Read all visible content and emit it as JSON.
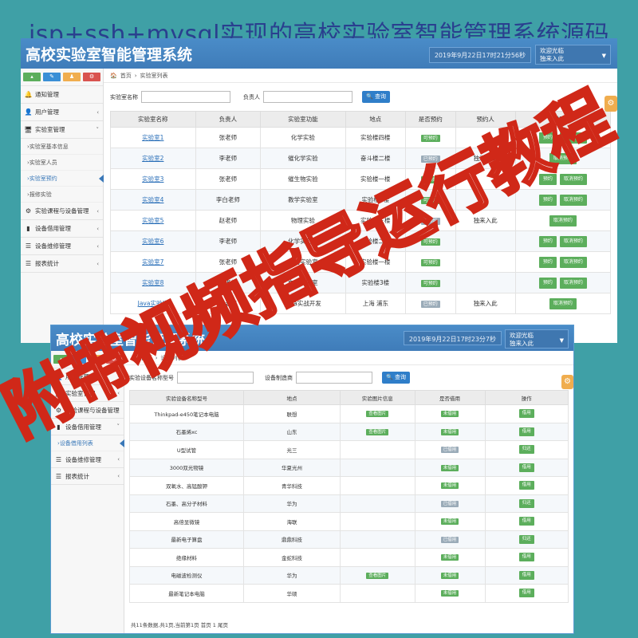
{
  "banner": "jsp+ssh+mysql实现的高校实验室智能管理系统源码",
  "watermark": "附带视频指导运行教程",
  "colors": {
    "header": "#3f7cb9",
    "accent": "#2f7ec9",
    "green": "#5cae5c",
    "gray": "#9aabb8",
    "watermark": "#d02818",
    "banner": "#2a3f8f"
  },
  "s1": {
    "title": "高校实验室智能管理系统",
    "datetime": "2019年9月22日17时21分56秒",
    "user_line1": "欢迎光临",
    "user_line2": "独来入此",
    "sidebar": {
      "items": [
        {
          "icon": "bell-icon",
          "glyph": "🔔",
          "label": "通知管理",
          "chev": ""
        },
        {
          "icon": "user-icon",
          "glyph": "👤",
          "label": "用户管理",
          "chev": "‹"
        },
        {
          "icon": "monitor-icon",
          "glyph": "🖥",
          "label": "实验室管理",
          "chev": "˅"
        }
      ],
      "subs": [
        "实验室基本信息",
        "实验室人员",
        "实验室预约",
        "报修实验"
      ],
      "items2": [
        {
          "icon": "gears-icon",
          "glyph": "⚙",
          "label": "实验课程与设备管理",
          "chev": "‹"
        },
        {
          "icon": "bookmark-icon",
          "glyph": "▮",
          "label": "设备借用管理",
          "chev": "‹"
        },
        {
          "icon": "list-icon",
          "glyph": "☰",
          "label": "设备维修管理",
          "chev": "‹"
        },
        {
          "icon": "list-icon",
          "glyph": "☰",
          "label": "报表统计",
          "chev": "‹"
        }
      ]
    },
    "crumb_home": "首页",
    "crumb_page": "实验室列表",
    "search": {
      "label1": "实验室名称",
      "label2": "负责人",
      "button": "查询"
    },
    "table": {
      "headers": [
        "实验室名称",
        "负责人",
        "实验室功能",
        "地点",
        "是否预约",
        "预约人",
        "操作"
      ],
      "rows": [
        {
          "name": "实验室1",
          "owner": "张老师",
          "func": "化学实验",
          "loc": "实验楼四楼",
          "status": "可预约",
          "sg": "g",
          "who": "",
          "acts": [
            "预约",
            "取消预约"
          ]
        },
        {
          "name": "实验室2",
          "owner": "李老师",
          "func": "催化学实验",
          "loc": "奋斗楼二楼",
          "status": "已预约",
          "sg": "gr",
          "who": "独来入此",
          "acts": [
            "取消预约"
          ]
        },
        {
          "name": "实验室3",
          "owner": "张老师",
          "func": "催生物实验",
          "loc": "实验楼一楼",
          "status": "可预约",
          "sg": "g",
          "who": "",
          "acts": [
            "预约",
            "取消预约"
          ]
        },
        {
          "name": "实验室4",
          "owner": "李白老师",
          "func": "教学实验室",
          "loc": "实验楼2楼",
          "status": "可预约",
          "sg": "g",
          "who": "",
          "acts": [
            "预约",
            "取消预约"
          ]
        },
        {
          "name": "实验室5",
          "owner": "赵老师",
          "func": "物理实验",
          "loc": "实验楼三楼",
          "status": "已预约",
          "sg": "gr",
          "who": "独来入此",
          "acts": [
            "取消预约"
          ]
        },
        {
          "name": "实验室6",
          "owner": "李老师",
          "func": "化学实验室",
          "loc": "实验楼二楼",
          "status": "可预约",
          "sg": "g",
          "who": "",
          "acts": [
            "预约",
            "取消预约"
          ]
        },
        {
          "name": "实验室7",
          "owner": "张老师",
          "func": "生物实验室",
          "loc": "实验楼一楼",
          "status": "可预约",
          "sg": "g",
          "who": "",
          "acts": [
            "预约",
            "取消预约"
          ]
        },
        {
          "name": "实验室8",
          "owner": "张老师",
          "func": "电路实验室",
          "loc": "实验楼3楼",
          "status": "可预约",
          "sg": "g",
          "who": "",
          "acts": [
            "预约",
            "取消预约"
          ]
        },
        {
          "name": "Java实验室",
          "owner": "张老师",
          "func": "Java实战开发",
          "loc": "上海 浦东",
          "status": "已预约",
          "sg": "gr",
          "who": "独来入此",
          "acts": [
            "取消预约"
          ]
        }
      ]
    }
  },
  "s2": {
    "title": "高校实验室智能管理系统",
    "datetime": "2019年9月22日17时23分7秒",
    "user_line1": "欢迎光临",
    "user_line2": "独来入此",
    "sidebar": {
      "items": [
        {
          "icon": "user-icon",
          "glyph": "👤",
          "label": "用户管理",
          "chev": "‹"
        },
        {
          "icon": "monitor-icon",
          "glyph": "🖥",
          "label": "实验室管理",
          "chev": "‹"
        },
        {
          "icon": "gears-icon",
          "glyph": "⚙",
          "label": "实验课程与设备管理",
          "chev": "‹"
        },
        {
          "icon": "bookmark-icon",
          "glyph": "▮",
          "label": "设备借用管理",
          "chev": "˅"
        }
      ],
      "subs": [
        "设备借用列表"
      ],
      "items2": [
        {
          "icon": "list-icon",
          "glyph": "☰",
          "label": "设备维修管理",
          "chev": "‹"
        },
        {
          "icon": "list-icon",
          "glyph": "☰",
          "label": "报表统计",
          "chev": "‹"
        }
      ]
    },
    "crumb_home": "首页",
    "crumb_page": "设备列表",
    "search": {
      "label1": "实验设备名称型号",
      "label2": "设备制造商",
      "button": "查询"
    },
    "table": {
      "headers": [
        "实验设备名称型号",
        "地点",
        "实验图片信息",
        "是否借用",
        "操作"
      ],
      "rows": [
        {
          "name": "Thinkpad-e450笔记本电脑",
          "loc": "联想",
          "img": "查看图片",
          "status": "未借用",
          "act": "借用"
        },
        {
          "name": "石墨烯xc",
          "loc": "山东",
          "img": "查看图片",
          "status": "未借用",
          "act": "借用"
        },
        {
          "name": "U型试管",
          "loc": "光三",
          "img": "",
          "status": "已借用",
          "act": "归还"
        },
        {
          "name": "3000双光物镜",
          "loc": "华夏光州",
          "img": "",
          "status": "未借用",
          "act": "借用"
        },
        {
          "name": "双氧水、高锰酸钾",
          "loc": "青华科技",
          "img": "",
          "status": "未借用",
          "act": "借用"
        },
        {
          "name": "石墨、高分子材料",
          "loc": "华为",
          "img": "",
          "status": "已借用",
          "act": "归还"
        },
        {
          "name": "高倍显微镜",
          "loc": "海联",
          "img": "",
          "status": "未借用",
          "act": "借用"
        },
        {
          "name": "最新电子算盘",
          "loc": "鼎鼎科技",
          "img": "",
          "status": "已借用",
          "act": "归还"
        },
        {
          "name": "绝缘材料",
          "loc": "金蛇科技",
          "img": "",
          "status": "未借用",
          "act": "借用"
        },
        {
          "name": "电磁波检测仪",
          "loc": "华为",
          "img": "查看图片",
          "status": "未借用",
          "act": "借用"
        },
        {
          "name": "最新笔记本电脑",
          "loc": "华硕",
          "img": "",
          "status": "未借用",
          "act": "借用"
        }
      ]
    },
    "footer": "共11条数据,共1页,当前第1页 首页 1 尾页"
  }
}
